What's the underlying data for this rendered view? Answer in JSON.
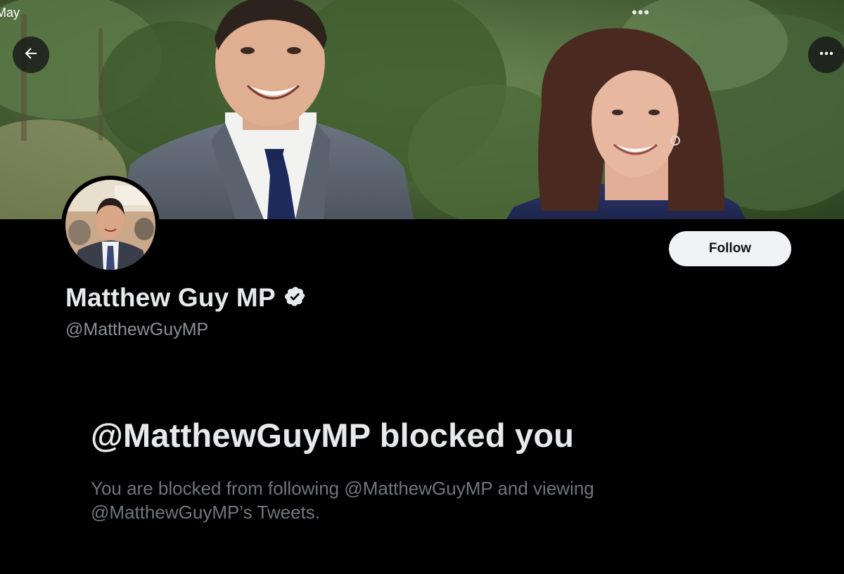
{
  "status_bar": {
    "time": "May",
    "dots": "•••"
  },
  "header": {
    "back_icon": "arrow-left-icon",
    "more_icon": "more-horizontal-icon"
  },
  "profile": {
    "display_name": "Matthew Guy MP",
    "verified_icon": "verified-badge-icon",
    "handle": "@MatthewGuyMP",
    "follow_label": "Follow"
  },
  "blocked_notice": {
    "title": "@MatthewGuyMP blocked you",
    "description_line1": "You are blocked from following @MatthewGuyMP and viewing",
    "description_line2": "@MatthewGuyMP’s Tweets."
  },
  "colors": {
    "background": "#000000",
    "primary_text": "#e7e9ea",
    "secondary_text": "#71767b",
    "follow_button_bg": "#eff3f4",
    "follow_button_text": "#0f1419"
  }
}
